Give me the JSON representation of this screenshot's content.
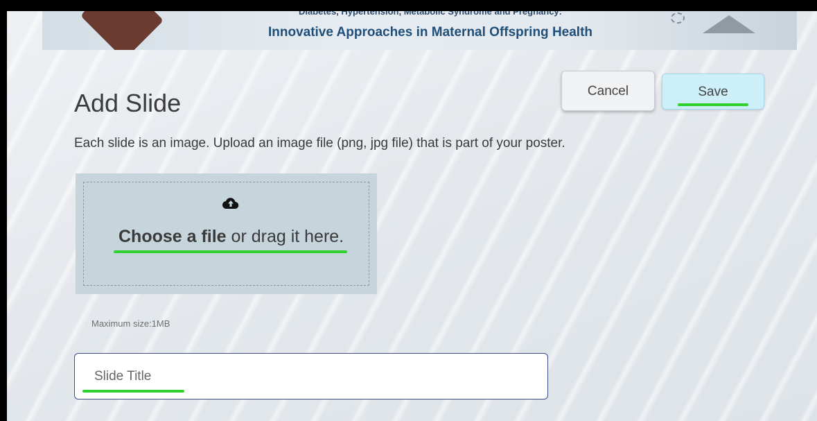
{
  "banner": {
    "subtitle": "Diabetes, Hypertension, Metabolic Syndrome and Pregnancy:",
    "title": "Innovative Approaches in Maternal Offspring Health"
  },
  "header": {
    "title": "Add Slide",
    "cancel_label": "Cancel",
    "save_label": "Save"
  },
  "description": "Each slide is an image. Upload an image file (png, jpg file) that is part of your poster.",
  "dropzone": {
    "icon": "cloud-upload-icon",
    "choose_label": "Choose a file",
    "drag_label": " or drag it here."
  },
  "hint": "Maximum size:1MB",
  "slide_title": {
    "placeholder": "Slide Title",
    "value": ""
  },
  "colors": {
    "save_bg": "#cdeffa",
    "dropzone_bg": "#c6d4dc",
    "input_border": "#3f4a8a",
    "highlight": "#2ed12e"
  }
}
